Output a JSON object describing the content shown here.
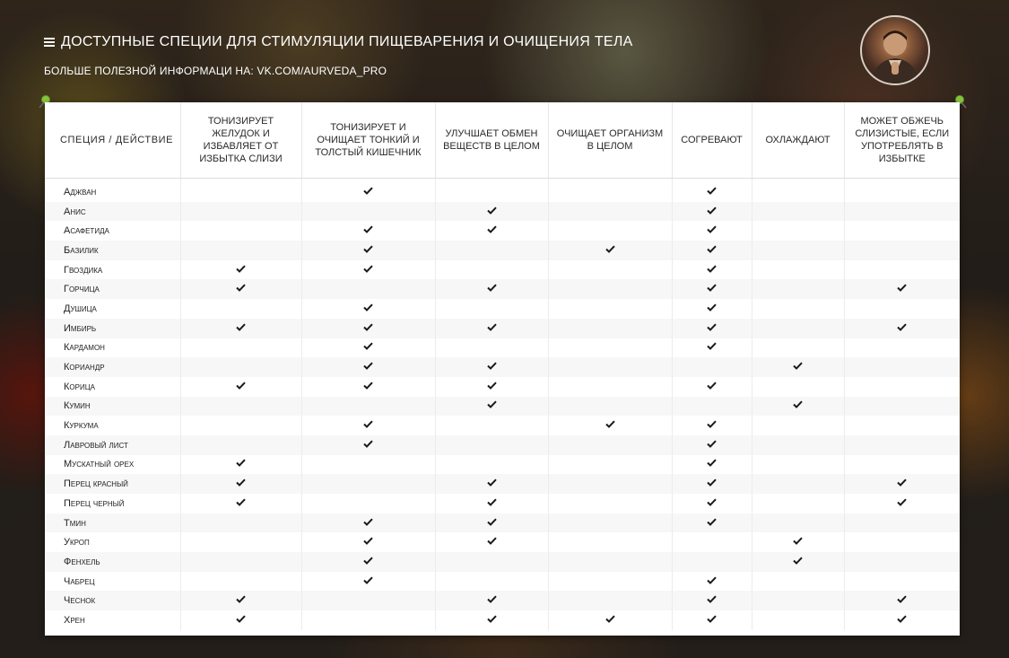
{
  "header": {
    "title": "Доступные специи для стимуляции пищеварения и очищения тела",
    "subtitle": "Больше полезной информаци на: vk.com/aurveda_pro"
  },
  "table": {
    "columns": [
      "Специя / действие",
      "Тонизирует желудок и избавляет от избытка слизи",
      "Тонизирует и очищает тонкий и толстый кишечник",
      "Улучшает обмен веществ в целом",
      "Очищает организм в целом",
      "Согревают",
      "Охлаждают",
      "Может обжечь слизистые, если употреблять в избытке"
    ],
    "rows": [
      {
        "name": "Аджван",
        "marks": [
          false,
          true,
          false,
          false,
          true,
          false,
          false
        ]
      },
      {
        "name": "Анис",
        "marks": [
          false,
          false,
          true,
          false,
          true,
          false,
          false
        ]
      },
      {
        "name": "Асафетида",
        "marks": [
          false,
          true,
          true,
          false,
          true,
          false,
          false
        ]
      },
      {
        "name": "Базилик",
        "marks": [
          false,
          true,
          false,
          true,
          true,
          false,
          false
        ]
      },
      {
        "name": "Гвоздика",
        "marks": [
          true,
          true,
          false,
          false,
          true,
          false,
          false
        ]
      },
      {
        "name": "Горчица",
        "marks": [
          true,
          false,
          true,
          false,
          true,
          false,
          true
        ]
      },
      {
        "name": "Душица",
        "marks": [
          false,
          true,
          false,
          false,
          true,
          false,
          false
        ]
      },
      {
        "name": "Имбирь",
        "marks": [
          true,
          true,
          true,
          false,
          true,
          false,
          true
        ]
      },
      {
        "name": "Кардамон",
        "marks": [
          false,
          true,
          false,
          false,
          true,
          false,
          false
        ]
      },
      {
        "name": "Кориандр",
        "marks": [
          false,
          true,
          true,
          false,
          false,
          true,
          false
        ]
      },
      {
        "name": "Корица",
        "marks": [
          true,
          true,
          true,
          false,
          true,
          false,
          false
        ]
      },
      {
        "name": "Кумин",
        "marks": [
          false,
          false,
          true,
          false,
          false,
          true,
          false
        ]
      },
      {
        "name": "Куркума",
        "marks": [
          false,
          true,
          false,
          true,
          true,
          false,
          false
        ]
      },
      {
        "name": "Лавровый лист",
        "marks": [
          false,
          true,
          false,
          false,
          true,
          false,
          false
        ]
      },
      {
        "name": "Мускатный орех",
        "marks": [
          true,
          false,
          false,
          false,
          true,
          false,
          false
        ]
      },
      {
        "name": "Перец красный",
        "marks": [
          true,
          false,
          true,
          false,
          true,
          false,
          true
        ]
      },
      {
        "name": "Перец черный",
        "marks": [
          true,
          false,
          true,
          false,
          true,
          false,
          true
        ]
      },
      {
        "name": "Тмин",
        "marks": [
          false,
          true,
          true,
          false,
          true,
          false,
          false
        ]
      },
      {
        "name": "Укроп",
        "marks": [
          false,
          true,
          true,
          false,
          false,
          true,
          false
        ]
      },
      {
        "name": "Фенхель",
        "marks": [
          false,
          true,
          false,
          false,
          false,
          true,
          false
        ]
      },
      {
        "name": "Чабрец",
        "marks": [
          false,
          true,
          false,
          false,
          true,
          false,
          false
        ]
      },
      {
        "name": "Чеснок",
        "marks": [
          true,
          false,
          true,
          false,
          true,
          false,
          true
        ]
      },
      {
        "name": "Хрен",
        "marks": [
          true,
          false,
          true,
          true,
          true,
          false,
          true
        ]
      }
    ]
  },
  "icons": {
    "menu": "menu-icon",
    "check": "checkmark-icon",
    "pin": "pushpin-icon",
    "avatar": "avatar-photo"
  },
  "colors": {
    "check": "#1a1a1a",
    "pin": "#8bc53f",
    "text_light": "#ffffff"
  }
}
